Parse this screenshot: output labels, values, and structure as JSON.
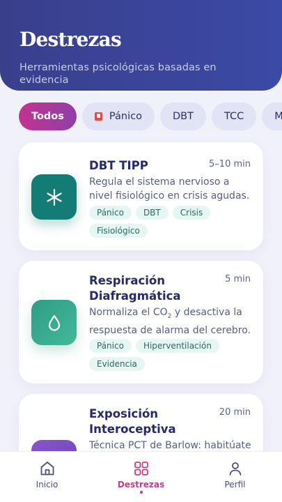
{
  "header": {
    "title": "Destrezas",
    "subtitle": "Herramientas psicológicas basadas en evidencia"
  },
  "filters": [
    {
      "label": "Todos",
      "active": true
    },
    {
      "label": "Pánico",
      "icon": "alarm-icon"
    },
    {
      "label": "DBT"
    },
    {
      "label": "TCC"
    },
    {
      "label": "Mi"
    }
  ],
  "cards": [
    {
      "title": "DBT TIPP",
      "duration": "5–10 min",
      "description": "Regula el sistema nervioso a nivel fisiológico en crisis agudas.",
      "icon": "asterisk-icon",
      "color": "#137c74",
      "tags": [
        "Pánico",
        "DBT",
        "Crisis",
        "Fisiológico"
      ]
    },
    {
      "title": "Respiración Diafragmática",
      "duration": "5 min",
      "description_before": "Normaliza el CO",
      "description_sub": "2",
      "description_after": " y desactiva la respuesta de alarma del cerebro.",
      "icon": "droplet-icon",
      "color": "#2f9d86",
      "tags": [
        "Pánico",
        "Hiperventilación",
        "Evidencia"
      ]
    },
    {
      "title": "Exposición Interoceptiva",
      "duration": "20 min",
      "description": "Técnica PCT de Barlow: habitúate",
      "color": "#8a54c9"
    }
  ],
  "nav": {
    "items": [
      {
        "label": "Inicio",
        "icon": "home-icon"
      },
      {
        "label": "Destrezas",
        "icon": "grid-icon",
        "active": true
      },
      {
        "label": "Perfil",
        "icon": "user-icon"
      }
    ]
  },
  "colors": {
    "accent": "#c43a8d",
    "header": "#3a3f8c",
    "background": "#f1f1fb"
  }
}
